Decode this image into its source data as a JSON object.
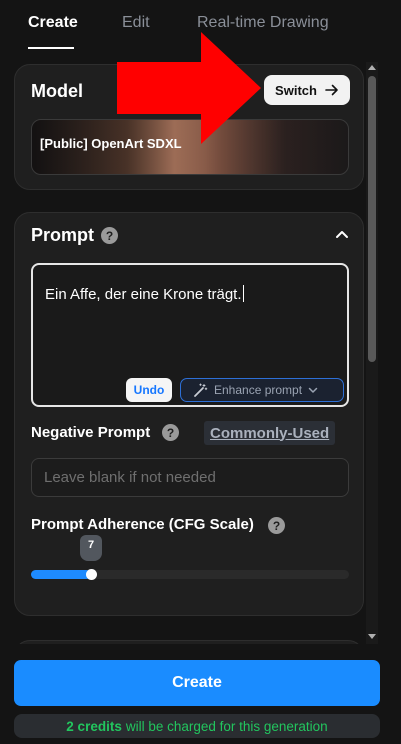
{
  "tabs": [
    {
      "label": "Create",
      "active": true
    },
    {
      "label": "Edit",
      "active": false
    },
    {
      "label": "Real-time Drawing",
      "active": false
    }
  ],
  "model": {
    "title": "Model",
    "switch_label": "Switch",
    "name": "[Public] OpenArt SDXL"
  },
  "prompt": {
    "title": "Prompt",
    "text": "Ein Affe, der eine Krone trägt.",
    "undo_label": "Undo",
    "enhance_label": "Enhance prompt"
  },
  "negative_prompt": {
    "label": "Negative Prompt",
    "commonly_used_label": "Commonly-Used",
    "placeholder": "Leave blank if not needed"
  },
  "cfg": {
    "label": "Prompt Adherence (CFG Scale)",
    "value": "7",
    "fill_fraction": 0.19
  },
  "footer": {
    "create_label": "Create",
    "credits_amount": "2 credits",
    "credits_suffix": "will be charged for this generation"
  },
  "colors": {
    "accent": "#1a8cff",
    "credits_green": "#22c55e",
    "annotation_arrow": "#ff0000"
  }
}
